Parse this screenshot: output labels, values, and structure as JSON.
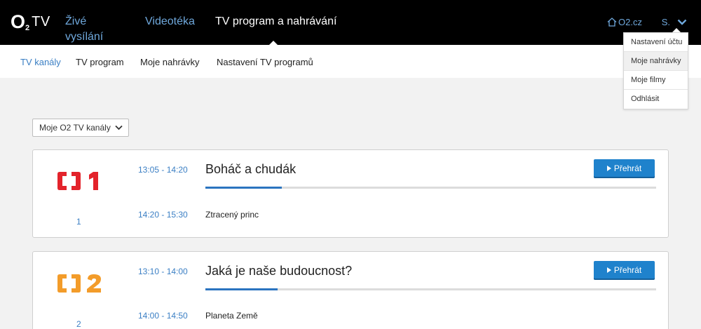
{
  "brand": {
    "logo_o": "O",
    "logo_two": "2",
    "logo_tv": "TV"
  },
  "mainnav": {
    "items": [
      "Živé vysílání",
      "Videotéka",
      "TV program a nahrávání"
    ],
    "active_index": 2
  },
  "header": {
    "o2_link": "O2.cz",
    "user_initial": "S."
  },
  "subnav": {
    "items": [
      "TV kanály",
      "TV program",
      "Moje nahrávky",
      "Nastavení TV programů"
    ],
    "active_index": 0
  },
  "user_menu": {
    "items": [
      "Nastavení účtu",
      "Moje nahrávky",
      "Moje filmy",
      "Odhlásit"
    ],
    "hover_index": 1
  },
  "filter": {
    "selected": "Moje O2 TV kanály"
  },
  "channels": [
    {
      "number": "1",
      "logo": "CT1",
      "color": "#e3232b",
      "current": {
        "time": "13:05 - 14:20",
        "title": "Boháč a chudák",
        "progress": 0.17
      },
      "next": {
        "time": "14:20 - 15:30",
        "title": "Ztracený princ"
      },
      "play_label": "Přehrát"
    },
    {
      "number": "2",
      "logo": "CT2",
      "color": "#f39c2a",
      "current": {
        "time": "13:10 - 14:00",
        "title": "Jaká je naše budoucnost?",
        "progress": 0.16
      },
      "next": {
        "time": "14:00 - 14:50",
        "title": "Planeta Země"
      },
      "play_label": "Přehrát"
    }
  ],
  "colors": {
    "accent": "#2b74c0",
    "link": "#6fa8dc",
    "button": "#1f82cc"
  }
}
